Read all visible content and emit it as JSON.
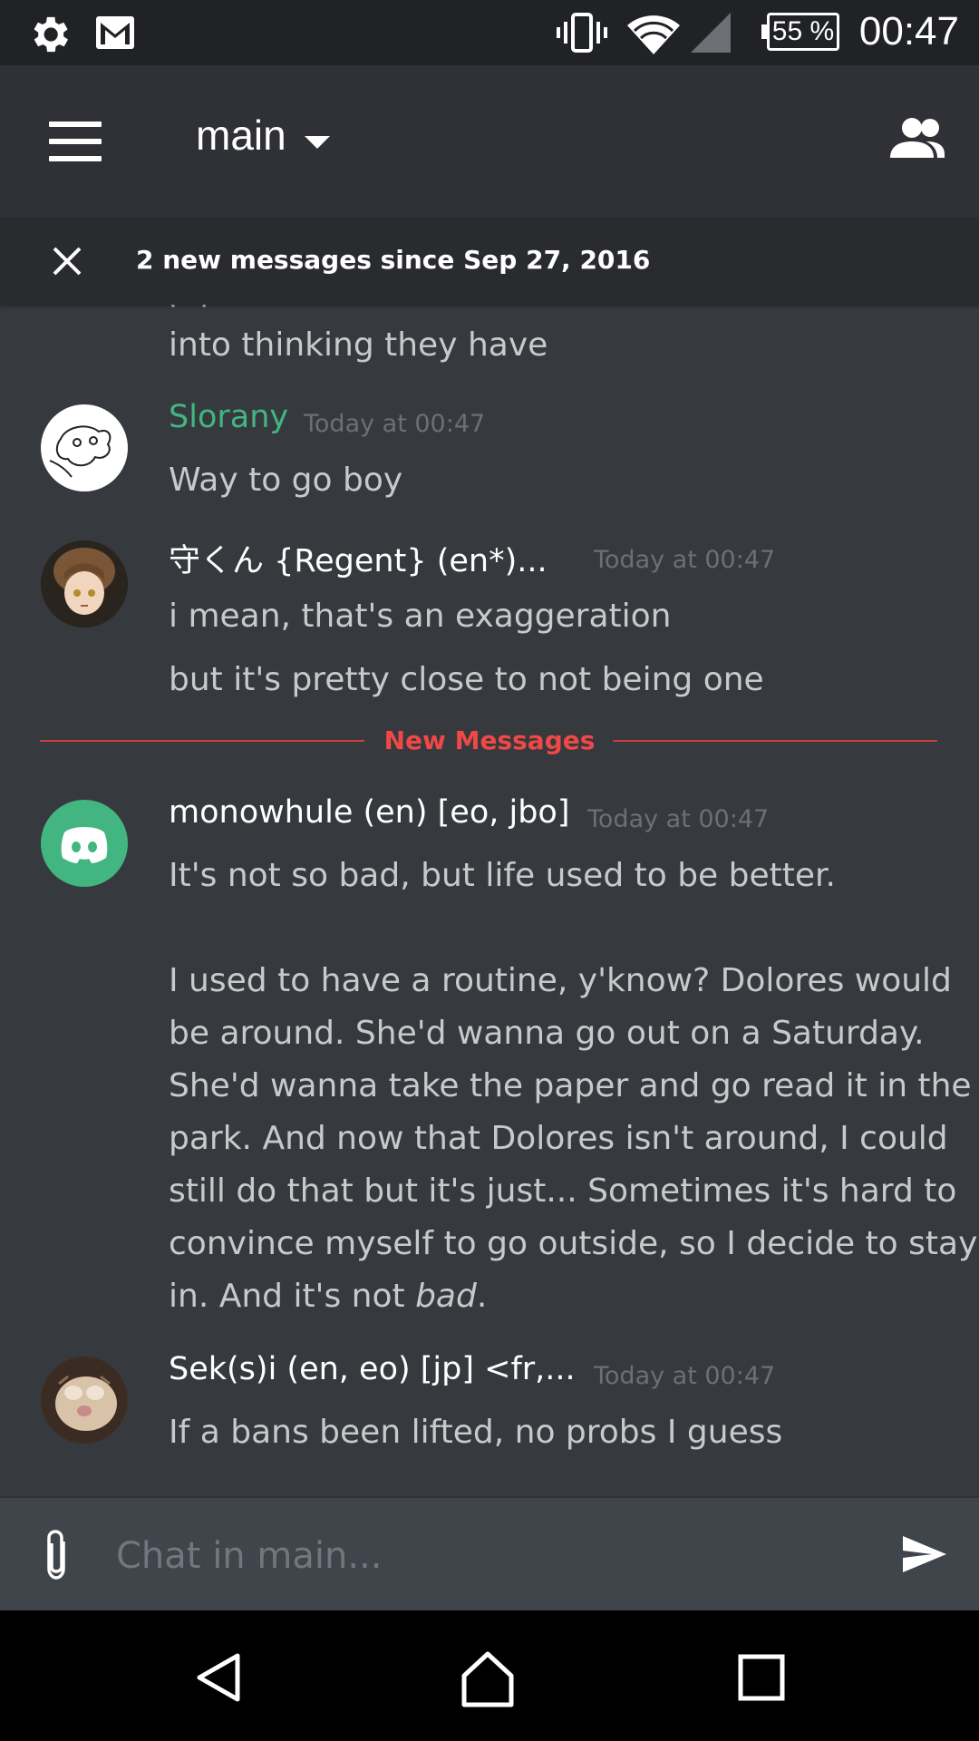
{
  "status_bar": {
    "time": "00:47",
    "battery": "55 %",
    "icons": [
      "settings-gear-icon",
      "gmail-icon",
      "vibrate-icon",
      "wifi-icon",
      "signal-icon",
      "battery-icon"
    ]
  },
  "app_bar": {
    "channel": "main",
    "icons": [
      "hamburger-menu-icon",
      "dropdown-caret-icon",
      "members-icon"
    ]
  },
  "banner": {
    "text": "2 new messages since Sep 27, 2016"
  },
  "messages": {
    "partial_top": "into thinking they have",
    "groups": [
      {
        "author": "Slorany",
        "author_color": "#43b581",
        "timestamp": "Today at 00:47",
        "lines": [
          "Way to go boy"
        ]
      },
      {
        "author": "守くん {Regent} (en*)...",
        "timestamp": "Today at 00:47",
        "lines": [
          "i mean, that's an exaggeration",
          "but it's pretty close to not being one"
        ]
      },
      {
        "author": "monowhule (en) [eo, jbo]",
        "timestamp": "Today at 00:47",
        "lines": [
          "It's not so bad, but life used to be better.",
          "I used to have a routine, y'know? Dolores would",
          "be around. She'd wanna go out on a Saturday.",
          "She'd wanna take the paper and go read it in the",
          "park. And now that Dolores isn't around, I could",
          "still do that but it's just... Sometimes it's hard to",
          "convince myself to go outside, so I decide to stay",
          "in. And it's not ",
          "bad",
          "."
        ]
      },
      {
        "author": "Sek(s)i (en, eo) [jp] <fr,...",
        "timestamp": "Today at 00:47",
        "lines": [
          "If a bans been lifted, no probs I guess"
        ]
      }
    ],
    "divider": "New Messages"
  },
  "composer": {
    "placeholder": "Chat in main..."
  },
  "colors": {
    "background": "#36393e",
    "appbar": "#2f3136",
    "new_messages_red": "#f04747",
    "discord_green": "#43b581"
  }
}
